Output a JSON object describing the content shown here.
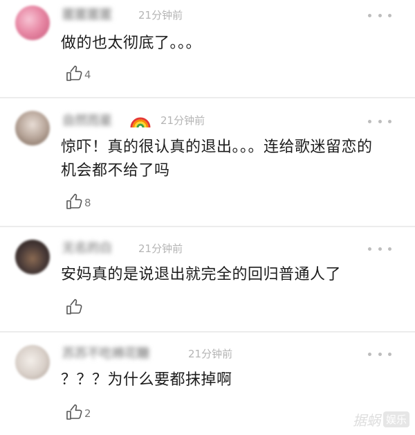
{
  "comments": [
    {
      "username": "匿匿匿匿",
      "time": "21分钟前",
      "text": "做的也太彻底了。。。",
      "likes": "4",
      "avatar_color": "#e88aa6"
    },
    {
      "username": "自然而星",
      "time": "21分钟前",
      "text": "惊吓！真的很认真的退出。。。连给歌迷留恋的机会都不给了吗",
      "likes": "8",
      "avatar_color": "#b8a69a"
    },
    {
      "username": "无名的白",
      "time": "21分钟前",
      "text": "安妈真的是说退出就完全的回归普通人了",
      "likes": "",
      "avatar_color": "#4a3b38"
    },
    {
      "username": "苏苏不吃棉花糖",
      "time": "21分钟前",
      "text": "？？？为什么要都抹掉啊",
      "likes": "2",
      "avatar_color": "#d8cfc8"
    }
  ],
  "watermark": {
    "text": "据蜗",
    "badge": "娱乐"
  },
  "icons": {
    "like": "thumbs-up-icon",
    "more": "more-dots-icon",
    "rainbow": "rainbow-emoji-icon"
  }
}
